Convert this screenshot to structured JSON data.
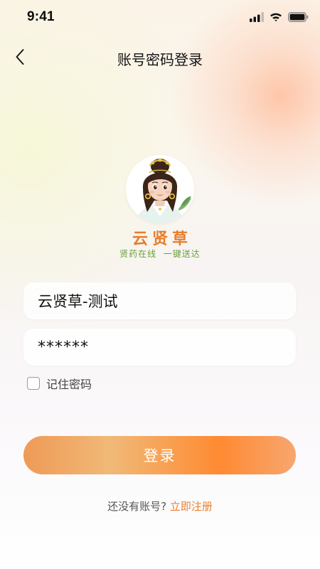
{
  "status_bar": {
    "time": "9:41",
    "icons": [
      "cellular-signal-icon",
      "wifi-icon",
      "battery-icon"
    ]
  },
  "nav": {
    "back_icon": "chevron-left-icon",
    "title": "账号密码登录"
  },
  "brand": {
    "name": "云贤草",
    "slogan": "贤药在线  一键送达",
    "logo_icon": "girl-avatar-logo",
    "name_color": "#e67d2b",
    "slogan_color": "#6a9e3f"
  },
  "form": {
    "username_value": "云贤草-测试",
    "password_value": "******",
    "remember_label": "记住密码",
    "remember_checked": false,
    "login_label": "登录"
  },
  "register": {
    "prompt": "还没有账号?",
    "link": "立即注册",
    "link_color": "#e97f2f"
  },
  "colors": {
    "accent": "#ff8a32",
    "button_gradient": [
      "#ef9a57",
      "#f0b977",
      "#ff8a32",
      "#f7a66f"
    ]
  }
}
